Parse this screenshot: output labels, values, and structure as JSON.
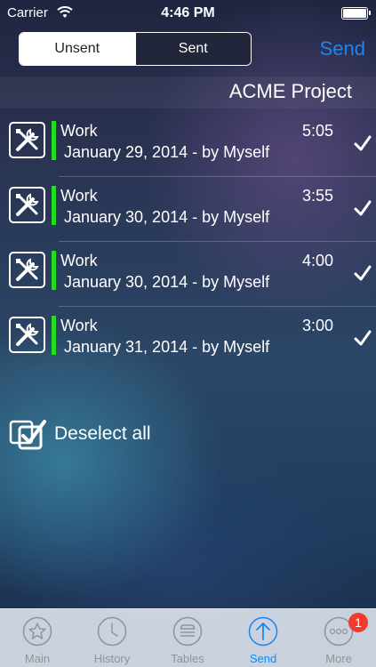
{
  "status_bar": {
    "carrier": "Carrier",
    "time": "4:46 PM"
  },
  "header": {
    "segments": [
      {
        "label": "Unsent",
        "selected": true
      },
      {
        "label": "Sent",
        "selected": false
      }
    ],
    "send_label": "Send",
    "accent_color": "#1a86f5"
  },
  "project": {
    "title": "ACME Project"
  },
  "entries": [
    {
      "icon": "tools-icon",
      "title": "Work",
      "subtitle": "January 29, 2014 - by Myself",
      "duration": "5:05",
      "checked": true,
      "color": "#22dd22"
    },
    {
      "icon": "tools-icon",
      "title": "Work",
      "subtitle": "January 30, 2014 - by Myself",
      "duration": "3:55",
      "checked": true,
      "color": "#22dd22"
    },
    {
      "icon": "tools-icon",
      "title": "Work",
      "subtitle": "January 30, 2014 - by Myself",
      "duration": "4:00",
      "checked": true,
      "color": "#22dd22"
    },
    {
      "icon": "tools-icon",
      "title": "Work",
      "subtitle": "January 31, 2014 - by Myself",
      "duration": "3:00",
      "checked": true,
      "color": "#22dd22"
    }
  ],
  "deselect": {
    "label": "Deselect all",
    "icon": "multi-check-icon"
  },
  "tab_bar": {
    "tabs": [
      {
        "label": "Main",
        "icon": "star-icon",
        "active": false
      },
      {
        "label": "History",
        "icon": "clock-icon",
        "active": false
      },
      {
        "label": "Tables",
        "icon": "tray-stack-icon",
        "active": false
      },
      {
        "label": "Send",
        "icon": "upload-arrow-icon",
        "active": true
      },
      {
        "label": "More",
        "icon": "more-dots-icon",
        "active": false,
        "badge": "1"
      }
    ]
  }
}
